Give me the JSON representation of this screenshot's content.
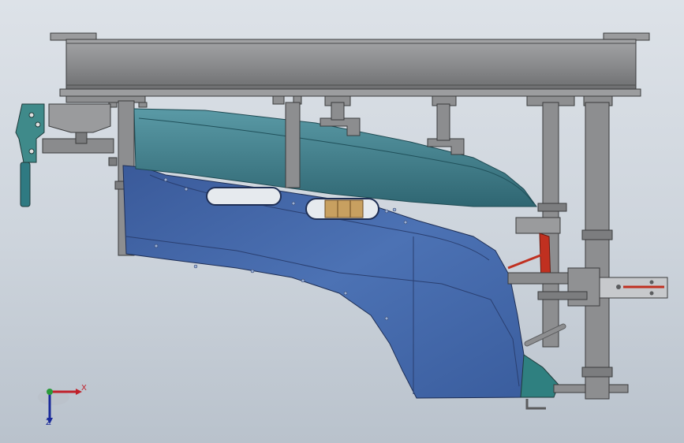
{
  "triad": {
    "x_label": "X",
    "z_label": "Z",
    "colors": {
      "x_axis": "#c0202a",
      "z_axis": "#1a2a9a",
      "origin": "#2a9a3a"
    }
  },
  "colors": {
    "background_top": "#dde2e8",
    "background_bottom": "#b9c2cc",
    "steel": "#8f9092",
    "steel_dark": "#5b5c5e",
    "teal_part": "#3f7e8c",
    "blue_part": "#4a6fb0",
    "accent_red": "#c03020",
    "accent_orange": "#c8a060"
  }
}
